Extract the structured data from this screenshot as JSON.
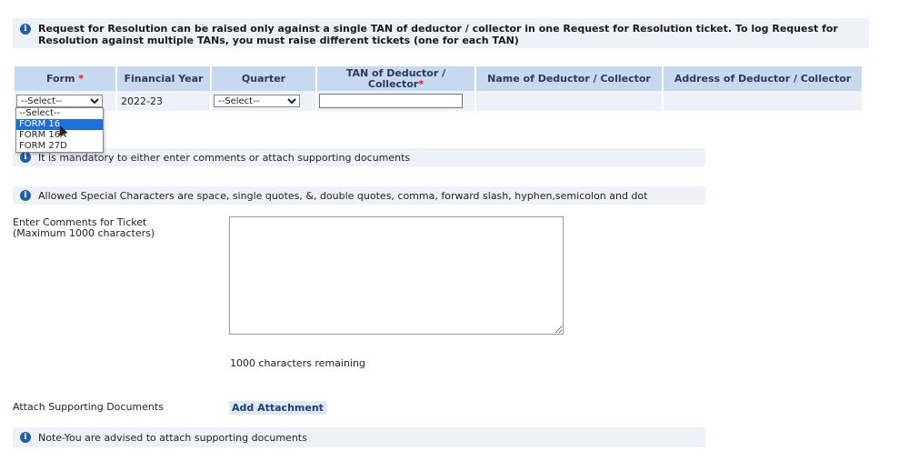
{
  "banner": {
    "text": "Request for Resolution can be raised only against a single TAN of deductor / collector in one Request for Resolution ticket. To log Request for Resolution against multiple TANs, you must raise different tickets (one for each TAN)"
  },
  "table": {
    "headers": {
      "form": "Form",
      "required_mark": "*",
      "financial_year": "Financial Year",
      "quarter": "Quarter",
      "tan": "TAN of Deductor / Collector",
      "name": "Name of Deductor / Collector",
      "address": "Address of Deductor / Collector"
    },
    "row": {
      "form_selected": "--Select--",
      "financial_year": "2022-23",
      "quarter_selected": "--Select--",
      "tan_value": ""
    }
  },
  "form_dropdown": {
    "options": [
      "--Select--",
      "FORM 16",
      "FORM 16A",
      "FORM 27D"
    ],
    "highlighted": "FORM 16"
  },
  "notes": {
    "mandatory": "It is mandatory to either enter comments or attach supporting documents",
    "special_chars": "Allowed Special Characters are space, single quotes, &, double quotes, comma, forward slash, hyphen,semicolon and dot",
    "advise": "Note-You are advised to attach supporting documents"
  },
  "comments": {
    "label_line1": "Enter Comments for Ticket",
    "label_line2": "(Maximum 1000 characters)",
    "remaining": "1000 characters remaining",
    "value": ""
  },
  "attachments": {
    "label": "Attach Supporting Documents",
    "button_label": "Add Attachment"
  },
  "colors": {
    "header_bg": "#c7d9ef",
    "note_bg": "#eef2f8",
    "info_icon": "#1d5ea8",
    "highlight": "#1e6fd9"
  },
  "icons": {
    "info": "info-icon"
  }
}
